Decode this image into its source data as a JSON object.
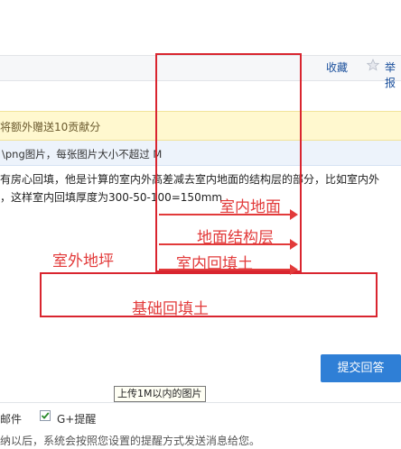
{
  "toolbar": {
    "favorite_label": "收藏",
    "report_label": "举报"
  },
  "notice": {
    "text": "将额外赠送10贡献分"
  },
  "upload_hint": {
    "text": "\\png图片，每张图片大小不超过 M"
  },
  "answer": {
    "line1": "有房心回填，他是计算的室内外高差减去室内地面的结构层的部分，比如室内外",
    "line2": "，这样室内回填厚度为300-50-100=150mm"
  },
  "annotations": {
    "indoor_floor": "室内地面",
    "floor_structure": "地面结构层",
    "outdoor_grade": "室外地坪",
    "indoor_backfill": "室内回填土",
    "foundation_backfill": "基础回填土"
  },
  "submit_label": "提交回答",
  "tooltip": "上传1M以内的图片",
  "options": {
    "email_label": "邮件",
    "gplus_label": "G+提醒",
    "gplus_checked": true
  },
  "bottom_note": "纳以后，系统会按照您设置的提醒方式发送消息给您。",
  "colors": {
    "annotation_red": "#e23a3a",
    "submit_blue": "#2f7fd6",
    "notice_bg": "#fff8cf",
    "hint_bg": "#edf3fb"
  }
}
